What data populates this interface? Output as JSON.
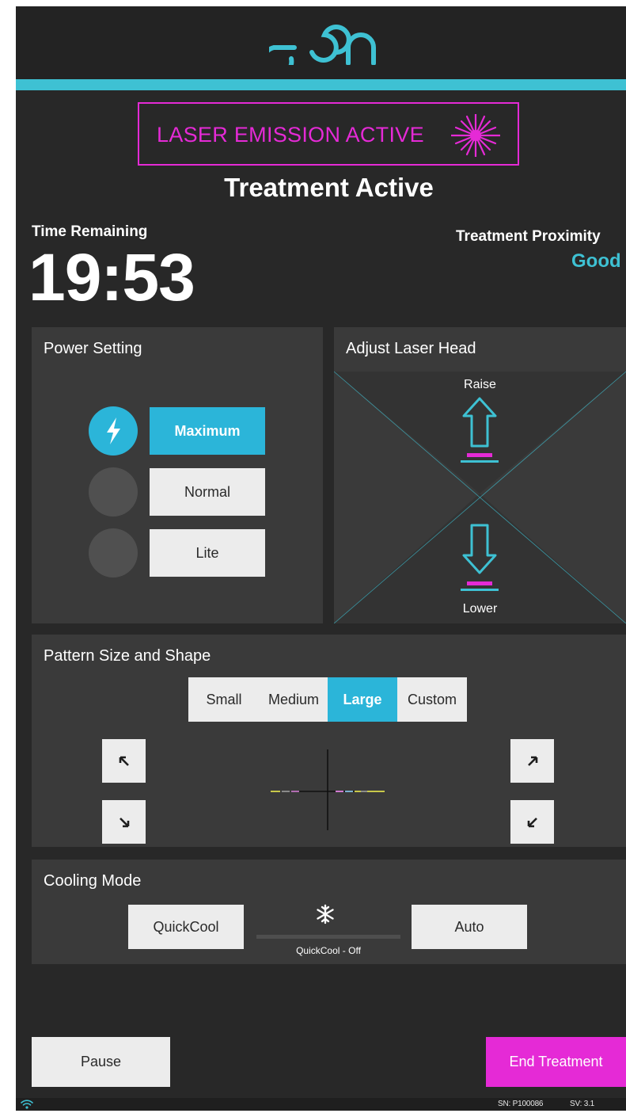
{
  "brand": {
    "logo_text": "eon",
    "accent": "#3ec1d3",
    "alert": "#e52ad6",
    "active": "#2bb5d9"
  },
  "banner": {
    "label": "LASER EMISSION ACTIVE",
    "icon": "laser-burst-icon"
  },
  "status": {
    "title": "Treatment Active"
  },
  "timer": {
    "label": "Time Remaining",
    "value": "19:53"
  },
  "proximity": {
    "label": "Treatment Proximity",
    "value": "Good"
  },
  "power": {
    "title": "Power Setting",
    "options": [
      "Maximum",
      "Normal",
      "Lite"
    ],
    "selected": "Maximum",
    "icon": "lightning-icon"
  },
  "laser_head": {
    "title": "Adjust Laser Head",
    "raise_label": "Raise",
    "lower_label": "Lower"
  },
  "pattern": {
    "title": "Pattern Size and Shape",
    "tabs": [
      "Small",
      "Medium",
      "Large",
      "Custom"
    ],
    "selected": "Large"
  },
  "cooling": {
    "title": "Cooling Mode",
    "quickcool_label": "QuickCool",
    "auto_label": "Auto",
    "status": "QuickCool - Off",
    "icon": "snowflake-icon"
  },
  "actions": {
    "pause_label": "Pause",
    "end_label": "End Treatment"
  },
  "footer": {
    "serial": "SN: P100086",
    "software": "SV: 3.1"
  }
}
